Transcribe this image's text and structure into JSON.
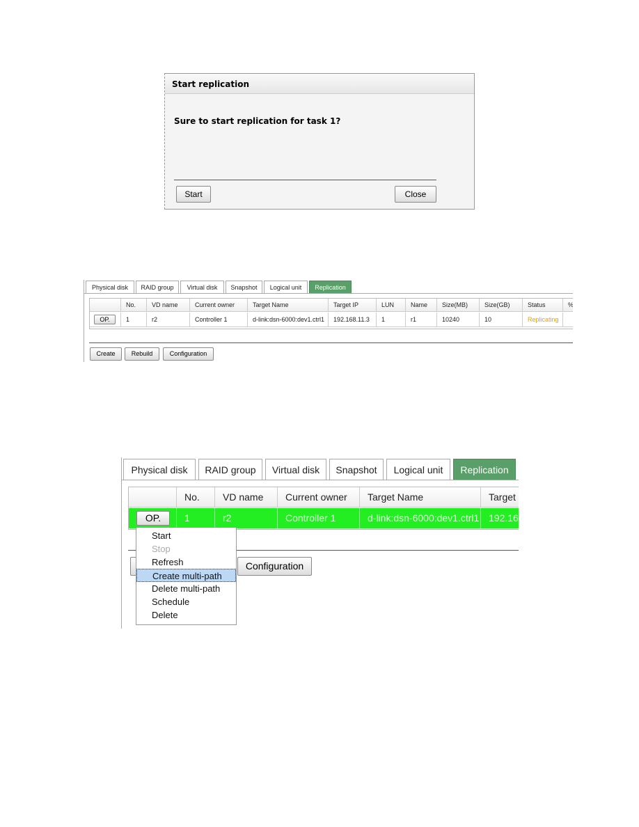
{
  "dialog": {
    "title": "Start replication",
    "message": "Sure to start replication for task 1?",
    "start": "Start",
    "close": "Close"
  },
  "tabs": [
    "Physical disk",
    "RAID group",
    "Virtual disk",
    "Snapshot",
    "Logical unit",
    "Replication"
  ],
  "table1": {
    "headers": [
      "",
      "No.",
      "VD name",
      "Current owner",
      "Target Name",
      "Target IP",
      "LUN",
      "Name",
      "Size(MB)",
      "Size(GB)",
      "Status",
      "%"
    ],
    "row": [
      "OP.",
      "1",
      "r2",
      "Controller 1",
      "d-link:dsn-6000:dev1.ctrl1",
      "192.168.11.3",
      "1",
      "r1",
      "10240",
      "10",
      "Replicating",
      ""
    ],
    "buttons": [
      "Create",
      "Rebuild",
      "Configuration"
    ],
    "status_color": "#e8a000"
  },
  "table2": {
    "headers": [
      "",
      "No.",
      "VD name",
      "Current owner",
      "Target Name",
      "Target"
    ],
    "row": [
      "OP.",
      "1",
      "r2",
      "Controller 1",
      "d-link:dsn-6000:dev1.ctrl1",
      "192.16"
    ],
    "row_color": "#22ee22",
    "config_button": "Configuration",
    "menu": [
      "Start",
      "Stop",
      "Refresh",
      "Create multi-path",
      "Delete multi-path",
      "Schedule",
      "Delete"
    ],
    "menu_disabled": "Stop",
    "menu_highlighted": "Create multi-path"
  }
}
